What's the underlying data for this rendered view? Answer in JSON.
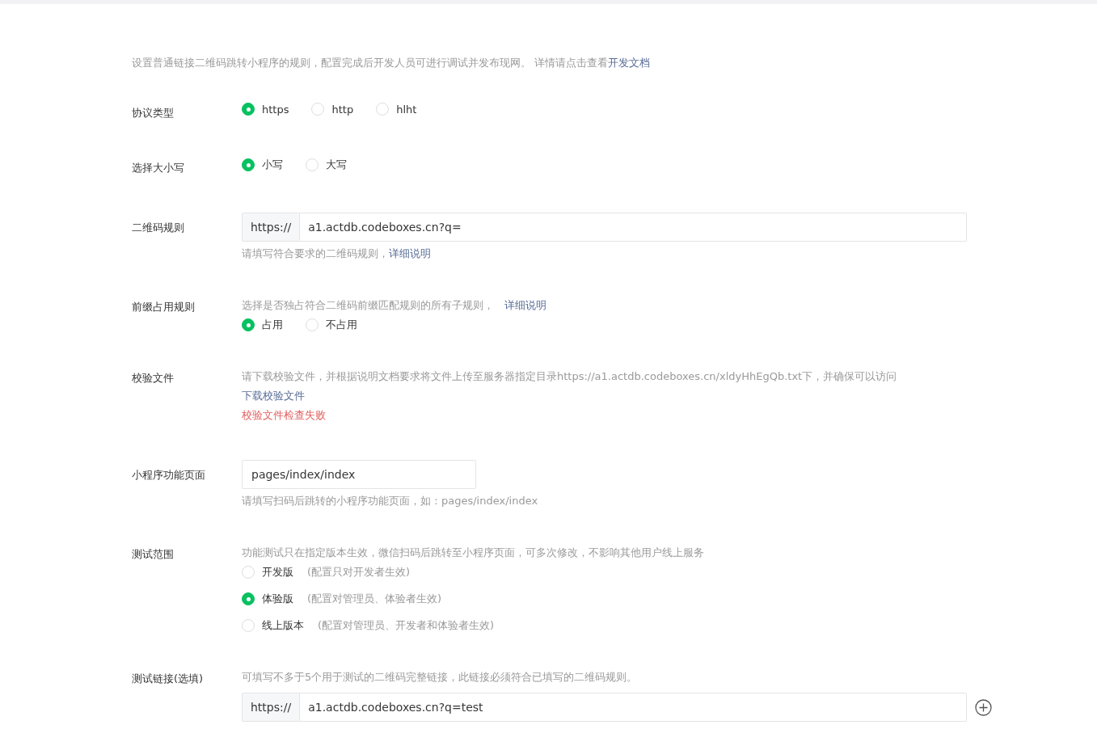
{
  "intro": {
    "text": "设置普通链接二维码跳转小程序的规则，配置完成后开发人员可进行调试并发布现网。 详情请点击查看",
    "link": "开发文档"
  },
  "rows": [
    {
      "kind": "radios",
      "label": "协议类型",
      "options": [
        {
          "label": "https",
          "selected": true
        },
        {
          "label": "http",
          "selected": false
        },
        {
          "label": "hlht",
          "selected": false
        }
      ]
    },
    {
      "kind": "radios",
      "label": "选择大小写",
      "options": [
        {
          "label": "小写",
          "selected": true
        },
        {
          "label": "大写",
          "selected": false
        }
      ]
    },
    {
      "kind": "prefixed_input",
      "label": "二维码规则",
      "prefix": "https://",
      "value": "a1.actdb.codeboxes.cn?q=",
      "hint": "请填写符合要求的二维码规则，",
      "hint_link": "详细说明"
    },
    {
      "kind": "desc_radios",
      "label": "前缀占用规则",
      "description": "选择是否独占符合二维码前缀匹配规则的所有子规则，",
      "description_link": "详细说明",
      "options": [
        {
          "label": "占用",
          "selected": true
        },
        {
          "label": "不占用",
          "selected": false
        }
      ]
    },
    {
      "kind": "file",
      "label": "校验文件",
      "description": "请下载校验文件，并根据说明文档要求将文件上传至服务器指定目录https://a1.actdb.codeboxes.cn/xldyHhEgQb.txt下，并确保可以访问",
      "link": "下载校验文件",
      "error": "校验文件检查失败"
    },
    {
      "kind": "input",
      "label": "小程序功能页面",
      "value": "pages/index/index",
      "hint": "请填写扫码后跳转的小程序功能页面，如：pages/index/index"
    },
    {
      "kind": "version_radios",
      "label": "测试范围",
      "description": "功能测试只在指定版本生效，微信扫码后跳转至小程序页面，可多次修改，不影响其他用户线上服务",
      "options": [
        {
          "label": "开发版",
          "note": "(配置只对开发者生效)",
          "selected": false
        },
        {
          "label": "体验版",
          "note": "(配置对管理员、体验者生效)",
          "selected": true
        },
        {
          "label": "线上版本",
          "note": "(配置对管理员、开发者和体验者生效)",
          "selected": false
        }
      ]
    },
    {
      "kind": "test_links",
      "label": "测试链接(选填)",
      "description": "可填写不多于5个用于测试的二维码完整链接，此链接必须符合已填写的二维码规则。",
      "prefix": "https://",
      "value": "a1.actdb.codeboxes.cn?q=test"
    }
  ]
}
